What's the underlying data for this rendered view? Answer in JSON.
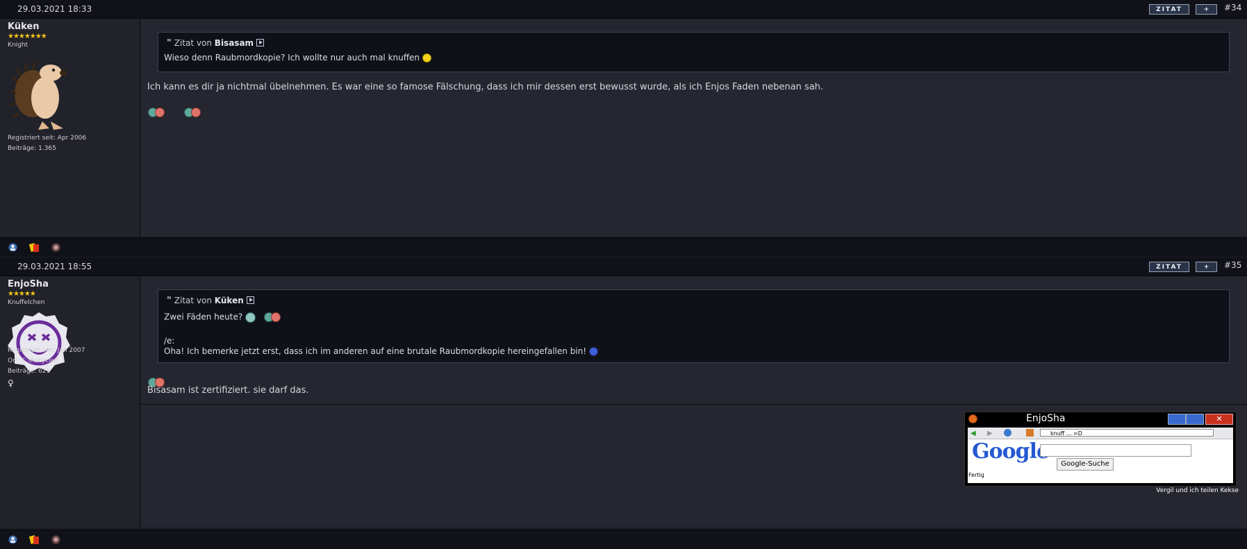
{
  "posts": [
    {
      "date": "29.03.2021 18:33",
      "number": "#34",
      "quote_label": "ZITAT",
      "plus_label": "+",
      "user": {
        "name": "Küken",
        "stars": "★★★★★★★",
        "rank": "Knight",
        "registered": "Registriert seit: Apr 2006",
        "posts": "Beiträge: 1.365"
      },
      "quote": {
        "prefix": "Zitat von",
        "author": "Bisasam",
        "text": "Wieso denn Raubmordkopie? Ich wollte nur auch mal knuffen"
      },
      "message": "Ich kann es dir ja nichtmal übelnehmen. Es war eine so famose Fälschung, dass ich mir dessen erst bewusst wurde, als ich Enjos Faden nebenan sah."
    },
    {
      "date": "29.03.2021 18:55",
      "number": "#35",
      "quote_label": "ZITAT",
      "plus_label": "+",
      "user": {
        "name": "EnjoSha",
        "stars": "★★★★★",
        "rank": "Knuffelchen",
        "registered": "Registriert seit: Jan 2007",
        "location": "Ort: C:\\Recycled..",
        "posts": "Beiträge: 621",
        "gender_symbol": "♀"
      },
      "quote": {
        "prefix": "Zitat von",
        "author": "Küken",
        "line1": "Zwei Fäden heute?",
        "edit_marker": "/e:",
        "line2": "Oha! Ich bemerke jetzt erst, dass ich im anderen auf eine brutale Raubmordkopie hereingefallen bin!"
      },
      "message": "Bisasam ist zertifiziert. sie darf das.",
      "signature": {
        "window_title": "EnjoSha",
        "address": "knuff ... =D",
        "google_logo": "Google",
        "search_button": "Google-Suche",
        "status": "Fertig",
        "caption": "Vergil und ich teilen Kekse"
      }
    }
  ],
  "icons": [
    "quote-arrow-icon",
    "smiley-pair-icon",
    "profile-icon",
    "yellow-card-icon",
    "report-icon",
    "gender-female-icon"
  ],
  "colors": {
    "background": "#25262f",
    "header": "#111219",
    "quote_bg": "#0f1119",
    "star": "#f5c518"
  }
}
